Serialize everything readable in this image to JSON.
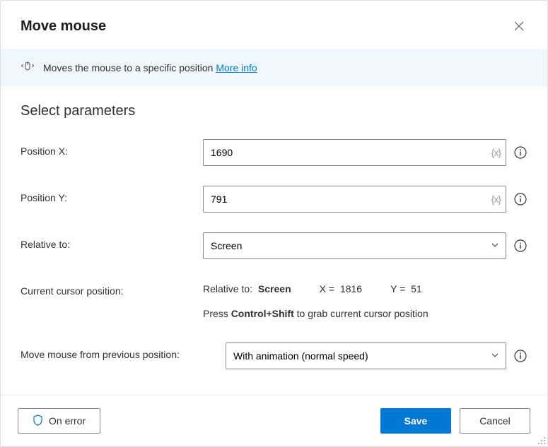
{
  "title": "Move mouse",
  "banner": {
    "text": "Moves the mouse to a specific position ",
    "link": "More info"
  },
  "section_title": "Select parameters",
  "fields": {
    "pos_x": {
      "label": "Position X:",
      "value": "1690"
    },
    "pos_y": {
      "label": "Position Y:",
      "value": "791"
    },
    "relative": {
      "label": "Relative to:",
      "value": "Screen"
    },
    "move_mode": {
      "label": "Move mouse from previous position:",
      "value": "With animation (normal speed)"
    }
  },
  "cursor": {
    "label": "Current cursor position:",
    "relative_lbl": "Relative to:",
    "relative_val": "Screen",
    "x_lbl": "X =",
    "x_val": "1816",
    "y_lbl": "Y =",
    "y_val": "51",
    "hint_pre": "Press ",
    "hint_kbd": "Control+Shift",
    "hint_post": " to grab current cursor position"
  },
  "footer": {
    "on_error": "On error",
    "save": "Save",
    "cancel": "Cancel"
  }
}
